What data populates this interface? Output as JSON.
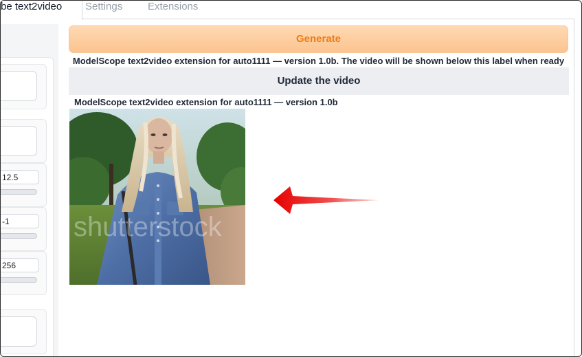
{
  "tabs": {
    "active_label": "be text2video",
    "settings_label": "Settings",
    "extensions_label": "Extensions"
  },
  "left_panel": {
    "cfg_value": "12.5",
    "seed_value": "-1",
    "size_value": "256"
  },
  "main": {
    "generate_label": "Generate",
    "status_text": "ModelScope text2video extension for auto1111 — version 1.0b. The video will be shown below this label when ready",
    "update_label": "Update the video",
    "video_label": "ModelScope text2video extension for auto1111 — version 1.0b",
    "watermark_text": "shutterstock"
  },
  "colors": {
    "generate_text": "#ea7d18",
    "generate_bg": "#fcc48f",
    "arrow": "#e60000"
  },
  "icons": {
    "arrow": "left-arrow-icon"
  }
}
